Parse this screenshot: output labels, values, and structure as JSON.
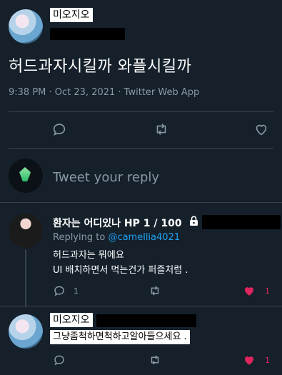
{
  "main_tweet": {
    "display_name": "미오지오",
    "text": "허드과자시킬까 와플시킬까",
    "meta": "9:38 PM · Oct 23, 2021 · Twitter Web App"
  },
  "reply_box": {
    "placeholder": "Tweet your reply"
  },
  "replies": [
    {
      "display_name": "환자는 어디있나 HP 1 / 100",
      "lock_icon": "lock-icon",
      "replying_to_prefix": "Replying to",
      "replying_to_handle": "@camellia4021",
      "text_line1": "허드과자는 뭐에요",
      "text_line2": "UI 배치하면서 먹는건가 퍼즐처럼 .",
      "reply_count": "1",
      "like_count": "1"
    },
    {
      "display_name": "미오지오",
      "text": "그냥좀척하면척하고알아들으세요 .",
      "like_count": "1"
    }
  ],
  "colors": {
    "background": "#15202b",
    "accent": "#1da1f2",
    "like": "#e0245e",
    "muted": "#8899a6"
  }
}
